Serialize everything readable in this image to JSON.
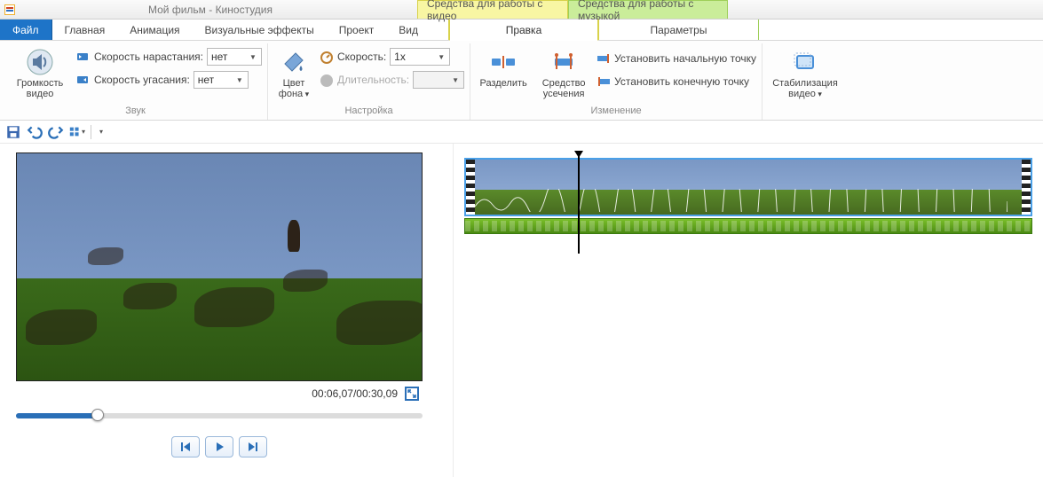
{
  "titlebar": {
    "title": "Мой фильм - Киностудия",
    "context_video": "Средства для работы с видео",
    "context_music": "Средства для работы с музыкой"
  },
  "tabs": {
    "file": "Файл",
    "home": "Главная",
    "animation": "Анимация",
    "visual_effects": "Визуальные эффекты",
    "project": "Проект",
    "view": "Вид",
    "edit": "Правка",
    "options": "Параметры"
  },
  "ribbon": {
    "video_volume": "Громкость видео",
    "fade_in_label": "Скорость нарастания:",
    "fade_in_value": "нет",
    "fade_out_label": "Скорость угасания:",
    "fade_out_value": "нет",
    "group_sound": "Звук",
    "bg_color": "Цвет фона",
    "speed_label": "Скорость:",
    "speed_value": "1x",
    "duration_label": "Длительность:",
    "duration_value": "",
    "group_settings": "Настройка",
    "split": "Разделить",
    "trim_tool": "Средство усечения",
    "set_start": "Установить начальную точку",
    "set_end": "Установить конечную точку",
    "group_edit": "Изменение",
    "stabilize": "Стабилизация видео"
  },
  "preview": {
    "time_current": "00:06,07",
    "time_total": "00:30,09",
    "progress_pct": 20
  }
}
